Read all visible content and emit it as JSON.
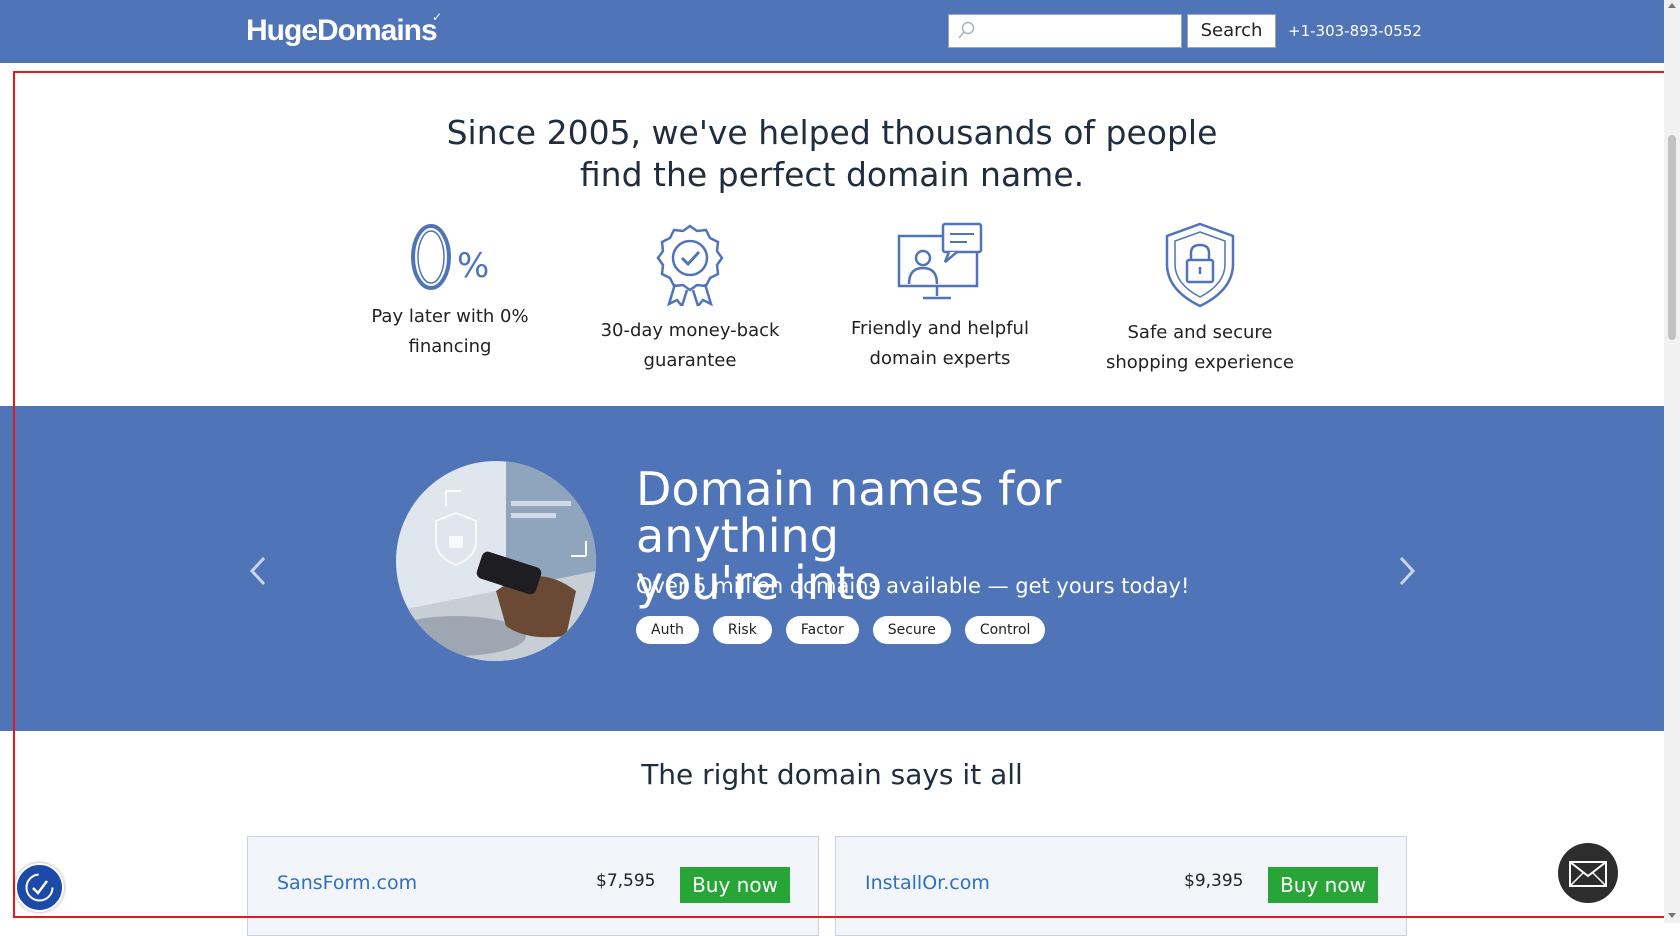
{
  "header": {
    "logo": "HugeDomains",
    "search_placeholder": "",
    "search_label": "Search",
    "phone": "+1-303-893-0552"
  },
  "hero": {
    "title_line1": "Since 2005, we've helped thousands of people",
    "title_line2": "find the perfect domain name.",
    "features": [
      {
        "icon": "zero-percent-icon",
        "line1": "Pay later with 0%",
        "line2": "financing"
      },
      {
        "icon": "award-ribbon-icon",
        "line1": "30-day money-back",
        "line2": "guarantee"
      },
      {
        "icon": "support-chat-icon",
        "line1": "Friendly and helpful",
        "line2": "domain experts"
      },
      {
        "icon": "shield-lock-icon",
        "line1": "Safe and secure",
        "line2": "shopping experience"
      }
    ]
  },
  "banner": {
    "heading_line1": "Domain names for anything",
    "heading_line2": "you're into",
    "subheading": "Over 5 million domains available — get yours today!",
    "tags": [
      "Auth",
      "Risk",
      "Factor",
      "Secure",
      "Control"
    ]
  },
  "domains": {
    "title": "The right domain says it all",
    "items": [
      {
        "name": "SansForm.com",
        "price": "$7,595",
        "cta": "Buy now"
      },
      {
        "name": "InstallOr.com",
        "price": "$9,395",
        "cta": "Buy now"
      }
    ]
  },
  "colors": {
    "brand_blue": "#4f74b8",
    "buy_green": "#27a637",
    "link_blue": "#2f6fc2",
    "frame_red": "#e4191e"
  }
}
